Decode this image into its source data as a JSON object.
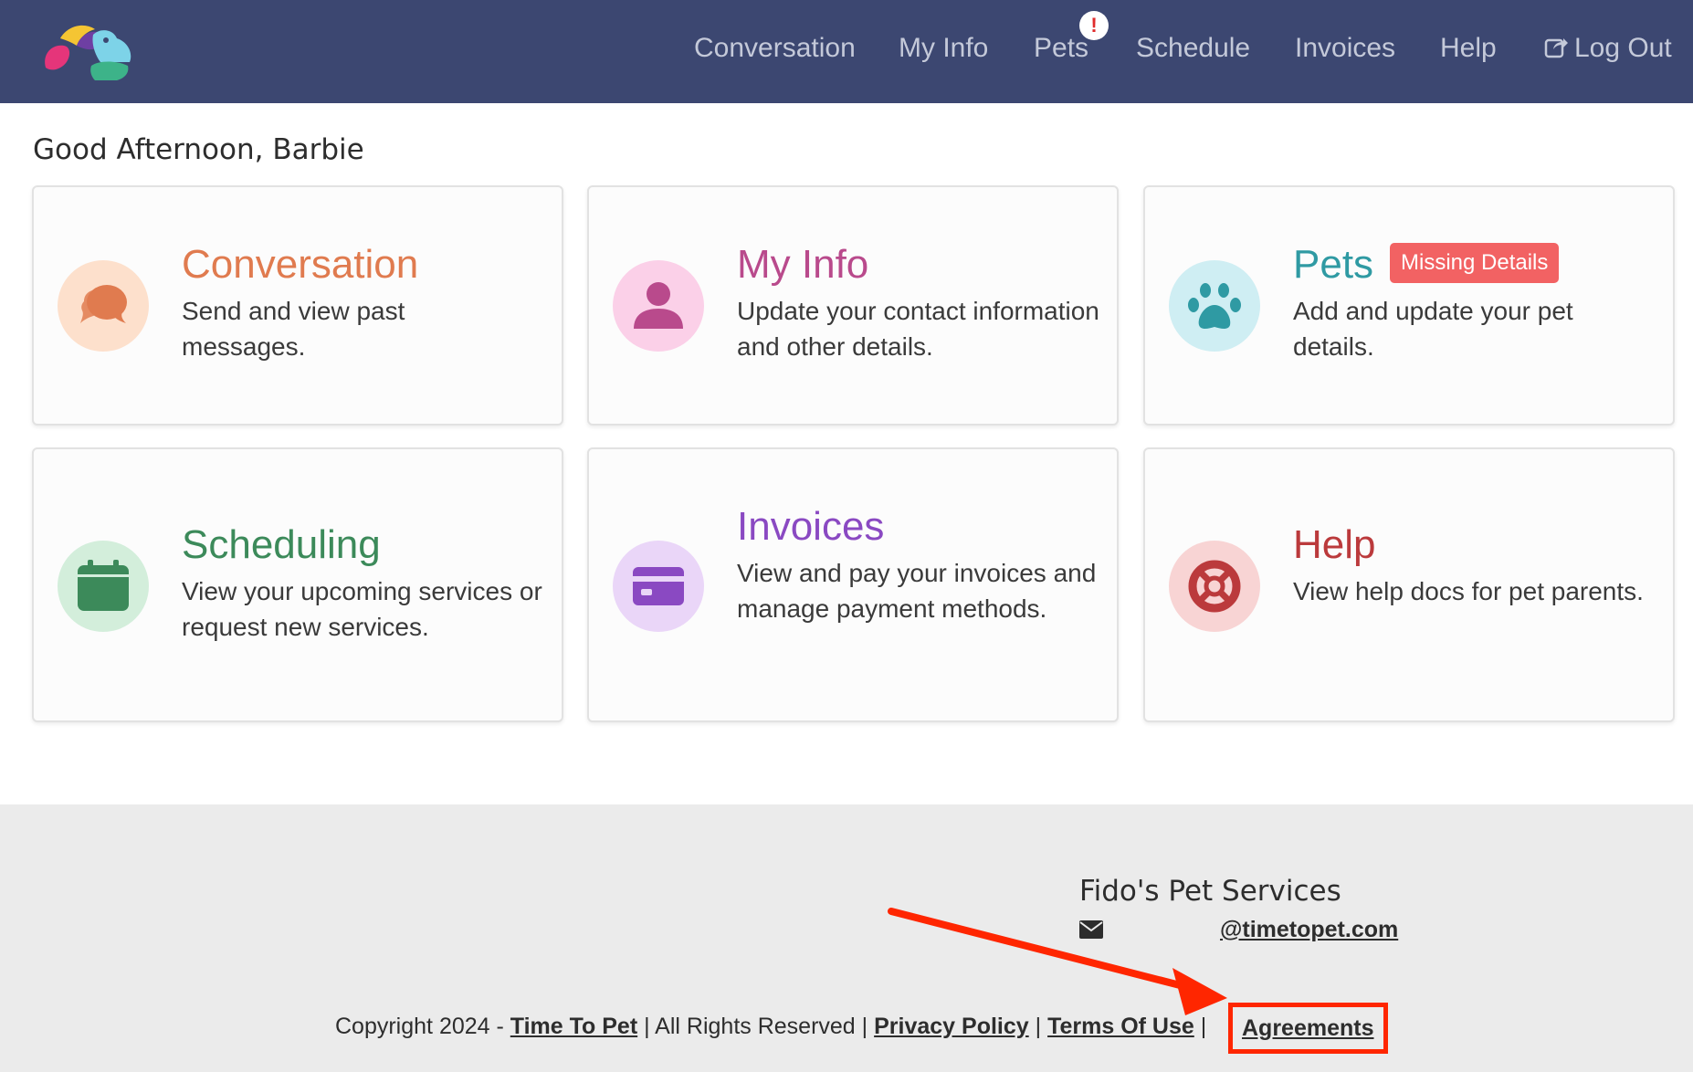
{
  "nav": {
    "items": [
      {
        "label": "Conversation"
      },
      {
        "label": "My Info"
      },
      {
        "label": "Pets",
        "alert": "!"
      },
      {
        "label": "Schedule"
      },
      {
        "label": "Invoices"
      },
      {
        "label": "Help"
      },
      {
        "label": "Log Out",
        "icon": "logout-icon"
      }
    ]
  },
  "greeting": "Good Afternoon, Barbie",
  "cards": [
    {
      "title": "Conversation",
      "description": "Send and view past messages.",
      "icon": "chat-bubbles-icon",
      "color": "#e07b4f",
      "bg": "#fde0cc"
    },
    {
      "title": "My Info",
      "description": "Update your contact information and other details.",
      "icon": "person-icon",
      "color": "#b94a8c",
      "bg": "#fbd0e8"
    },
    {
      "title": "Pets",
      "description": "Add and update your pet details.",
      "icon": "paw-icon",
      "color": "#2f9aa3",
      "bg": "#cfeef3",
      "badge": "Missing Details"
    },
    {
      "title": "Scheduling",
      "description": "View your upcoming services or request new services.",
      "icon": "calendar-icon",
      "color": "#3c8a5a",
      "bg": "#d3eedb"
    },
    {
      "title": "Invoices",
      "description": "View and pay your invoices and manage payment methods.",
      "icon": "credit-card-icon",
      "color": "#8a49c2",
      "bg": "#ead6f8"
    },
    {
      "title": "Help",
      "description": "View help docs for pet parents.",
      "icon": "life-ring-icon",
      "color": "#bb3a3c",
      "bg": "#f8d4d4"
    }
  ],
  "footer": {
    "company": "Fido's Pet Services",
    "email": "@timetopet.com",
    "copyright_prefix": "Copyright 2024 - ",
    "time_to_pet": "Time To Pet",
    "all_rights": " | All Rights Reserved | ",
    "privacy": "Privacy Policy",
    "sep": " | ",
    "terms": "Terms Of Use",
    "sep2": "  |",
    "agreements": "Agreements"
  },
  "colors": {
    "navbar": "#3c4771",
    "highlight": "#ff2600",
    "badge": "#f26263"
  }
}
